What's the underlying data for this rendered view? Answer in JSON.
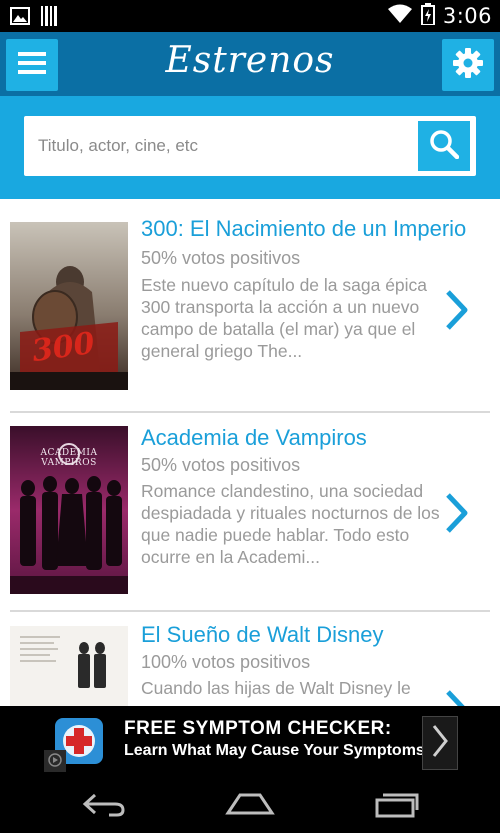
{
  "status_bar": {
    "time": "3:06",
    "icons": [
      "image-notification-icon",
      "barcode-notification-icon",
      "wifi-icon",
      "battery-icon"
    ]
  },
  "app_bar": {
    "title": "Estrenos",
    "menu_icon": "hamburger-menu-icon",
    "settings_icon": "gear-icon"
  },
  "search": {
    "placeholder": "Titulo, actor, cine, etc",
    "value": "",
    "icon": "search-icon"
  },
  "movies": [
    {
      "title": "300: El Nacimiento de un Imperio",
      "votes": "50% votos positivos",
      "description": "Este nuevo capítulo de la saga épica 300 transporta la acción a un nuevo campo de batalla (el mar) ya que el general griego The...",
      "poster_text": "300"
    },
    {
      "title": "Academia de Vampiros",
      "votes": "50% votos positivos",
      "description": "Romance clandestino, una sociedad despiadada y rituales nocturnos de los que nadie puede hablar. Todo esto ocurre en la Academi...",
      "poster_text": "ACADEMIA VAMPIROS"
    },
    {
      "title": "El Sueño de Walt Disney",
      "votes": "100% votos positivos",
      "description": "Cuando las hijas de Walt Disney le"
    }
  ],
  "ad": {
    "title": "FREE SYMPTOM CHECKER:",
    "subtitle": "Learn What May Cause Your Symptoms"
  },
  "nav_bar": {
    "icons": [
      "back-icon",
      "home-icon",
      "recent-apps-icon"
    ]
  },
  "colors": {
    "app_bar": "#0b6fa4",
    "accent": "#1fb1e4",
    "search_bg": "#19a8e0",
    "title_text": "#1a9fd9",
    "secondary_text": "#9a9a9a"
  }
}
